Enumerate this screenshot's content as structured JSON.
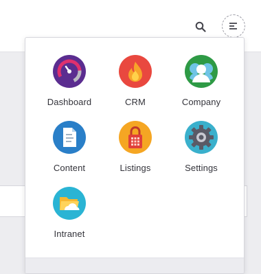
{
  "topbar": {
    "search_icon": "search-icon",
    "menu_icon": "menu-icon"
  },
  "app_menu": {
    "items": [
      {
        "label": "Dashboard",
        "icon": "dashboard-icon",
        "color": "#5b2d90"
      },
      {
        "label": "CRM",
        "icon": "flame-icon",
        "color": "#e9483f"
      },
      {
        "label": "Company",
        "icon": "company-icon",
        "color": "#2e9a45"
      },
      {
        "label": "Content",
        "icon": "document-icon",
        "color": "#2a7fc8"
      },
      {
        "label": "Listings",
        "icon": "padlock-icon",
        "color": "#f5a623"
      },
      {
        "label": "Settings",
        "icon": "gear-icon",
        "color": "#3ab0cc"
      },
      {
        "label": "Intranet",
        "icon": "folder-icon",
        "color": "#2ab4d4"
      }
    ]
  }
}
